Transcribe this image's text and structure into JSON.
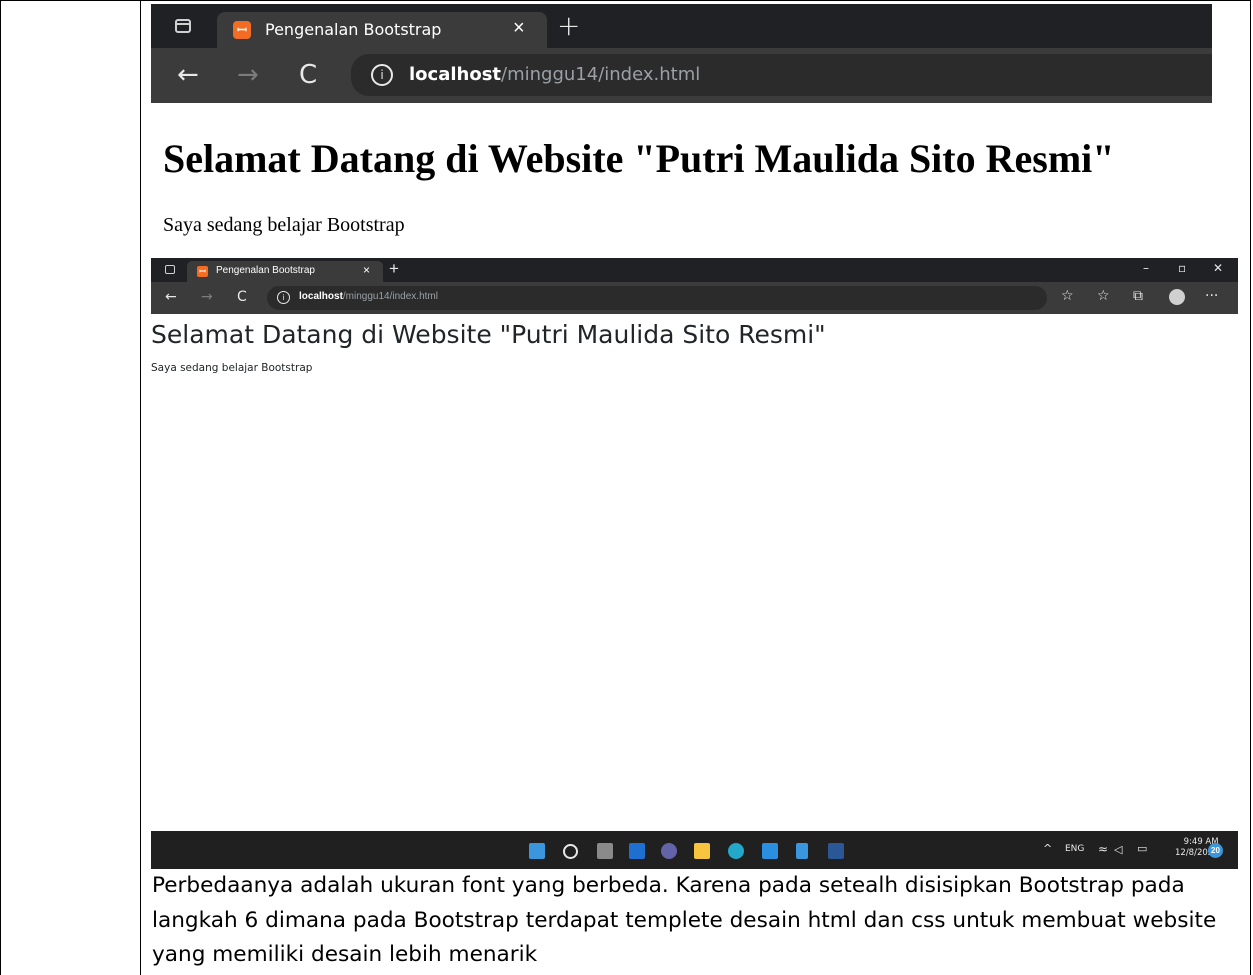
{
  "shot1": {
    "tab_title": "Pengenalan Bootstrap",
    "tab_close": "×",
    "new_tab": "+",
    "nav": {
      "back": "←",
      "forward": "→",
      "reload": "C"
    },
    "address": {
      "info": "i",
      "host": "localhost",
      "path": "/minggu14/index.html"
    }
  },
  "page_plain": {
    "heading": "Selamat Datang di Website \"Putri Maulida Sito Resmi\"",
    "paragraph": "Saya sedang belajar Bootstrap"
  },
  "shot2": {
    "tab_title": "Pengenalan Bootstrap",
    "tab_close": "×",
    "new_tab": "+",
    "window": {
      "minimize": "–",
      "restore": "▫",
      "close": "✕"
    },
    "nav": {
      "back": "←",
      "forward": "→",
      "reload": "C"
    },
    "address": {
      "info": "i",
      "host": "localhost",
      "path": "/minggu14/index.html"
    },
    "toolbar": {
      "favorite_add": "☆",
      "favorites": "☆",
      "collections": "⧉",
      "more": "···"
    },
    "page": {
      "heading": "Selamat Datang di Website \"Putri Maulida Sito Resmi\"",
      "paragraph": "Saya sedang belajar Bootstrap"
    },
    "taskbar": {
      "apps": [
        "start",
        "search",
        "task-view",
        "widgets",
        "teams-chat",
        "file-explorer",
        "edge",
        "vscode",
        "notepad",
        "word"
      ],
      "tray": {
        "chevron": "^",
        "lang": "ENG",
        "wifi": "≈",
        "volume": "◁",
        "battery": "▭"
      },
      "time": "9:49 AM",
      "date": "12/8/2021",
      "notification_count": "20"
    }
  },
  "caption": "Perbedaanya adalah ukuran font yang berbeda. Karena pada setealh disisipkan Bootstrap pada langkah 6 dimana pada Bootstrap terdapat templete desain html dan css untuk membuat website yang memiliki desain lebih menarik",
  "colors": {
    "browser_dark": "#202124",
    "toolbar": "#3b3b3b",
    "favicon": "#f26c24",
    "notification": "#3a96dd"
  }
}
